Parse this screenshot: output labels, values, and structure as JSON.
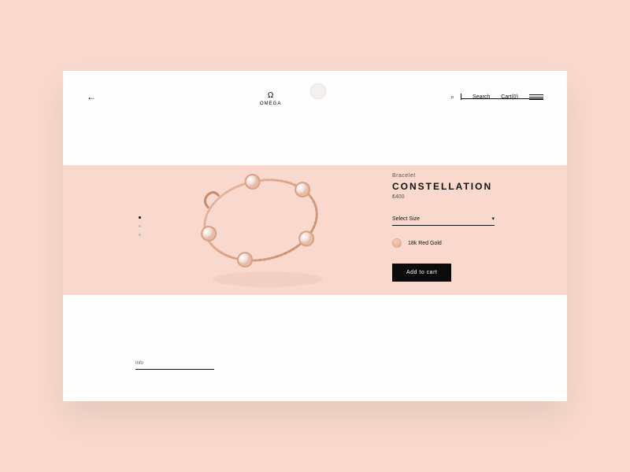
{
  "header": {
    "brand": "OMEGA",
    "brand_mark": "Ω",
    "search_label": "Search",
    "cart_label": "Cart(0)"
  },
  "product": {
    "category": "Bracelet",
    "title": "CONSTELLATION",
    "price": "₤400",
    "size_select_label": "Select Size",
    "material_label": "18k Red Gold",
    "add_to_cart_label": "Add to cart"
  },
  "footer": {
    "info_label": "Info"
  },
  "colors": {
    "peach": "#f9d9cd",
    "black": "#0b0b0b",
    "rose_gold": "#d59a7f"
  }
}
